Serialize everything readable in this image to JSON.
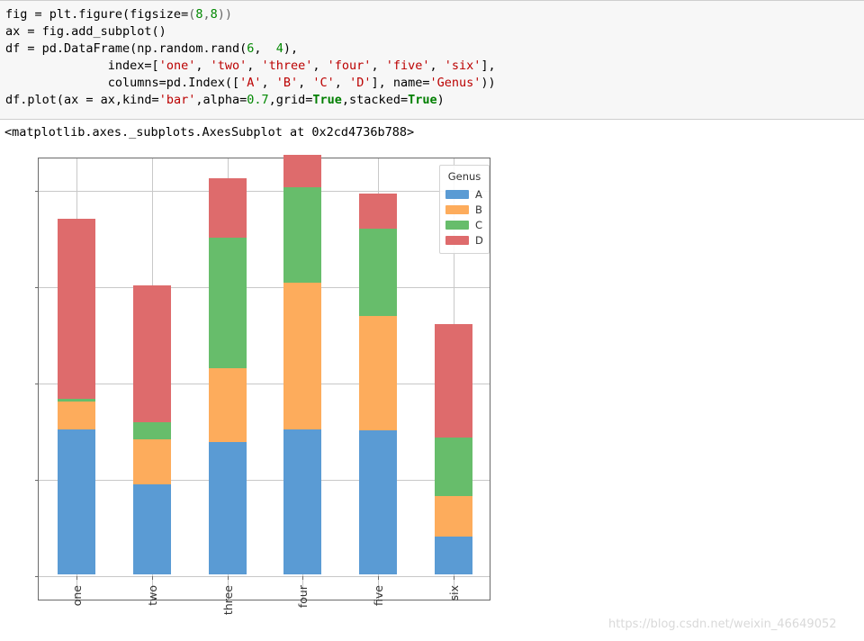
{
  "code_cell": {
    "lines": [
      [
        {
          "t": "fig = plt.figure(figsize=",
          "c": "pl"
        },
        {
          "t": "(",
          "c": "op"
        },
        {
          "t": "8",
          "c": "num"
        },
        {
          "t": ",",
          "c": "op"
        },
        {
          "t": "8",
          "c": "num"
        },
        {
          "t": "))",
          "c": "op"
        }
      ],
      [
        {
          "t": "ax = fig.add_subplot()",
          "c": "pl"
        }
      ],
      [
        {
          "t": "df = pd.DataFrame(np.random.rand(",
          "c": "pl"
        },
        {
          "t": "6",
          "c": "num"
        },
        {
          "t": ",  ",
          "c": "pl"
        },
        {
          "t": "4",
          "c": "num"
        },
        {
          "t": "),",
          "c": "pl"
        }
      ],
      [
        {
          "t": "              index=[",
          "c": "pl"
        },
        {
          "t": "'one'",
          "c": "str"
        },
        {
          "t": ", ",
          "c": "pl"
        },
        {
          "t": "'two'",
          "c": "str"
        },
        {
          "t": ", ",
          "c": "pl"
        },
        {
          "t": "'three'",
          "c": "str"
        },
        {
          "t": ", ",
          "c": "pl"
        },
        {
          "t": "'four'",
          "c": "str"
        },
        {
          "t": ", ",
          "c": "pl"
        },
        {
          "t": "'five'",
          "c": "str"
        },
        {
          "t": ", ",
          "c": "pl"
        },
        {
          "t": "'six'",
          "c": "str"
        },
        {
          "t": "],",
          "c": "pl"
        }
      ],
      [
        {
          "t": "              columns=pd.Index([",
          "c": "pl"
        },
        {
          "t": "'A'",
          "c": "str"
        },
        {
          "t": ", ",
          "c": "pl"
        },
        {
          "t": "'B'",
          "c": "str"
        },
        {
          "t": ", ",
          "c": "pl"
        },
        {
          "t": "'C'",
          "c": "str"
        },
        {
          "t": ", ",
          "c": "pl"
        },
        {
          "t": "'D'",
          "c": "str"
        },
        {
          "t": "], name=",
          "c": "pl"
        },
        {
          "t": "'Genus'",
          "c": "str"
        },
        {
          "t": "))",
          "c": "pl"
        }
      ],
      [
        {
          "t": "df.plot(ax = ax,kind=",
          "c": "pl"
        },
        {
          "t": "'bar'",
          "c": "str"
        },
        {
          "t": ",alpha=",
          "c": "pl"
        },
        {
          "t": "0.7",
          "c": "num"
        },
        {
          "t": ",grid=",
          "c": "pl"
        },
        {
          "t": "True",
          "c": "kw"
        },
        {
          "t": ",stacked=",
          "c": "pl"
        },
        {
          "t": "True",
          "c": "kw"
        },
        {
          "t": ")",
          "c": "pl"
        }
      ]
    ]
  },
  "output": {
    "repr_text": "<matplotlib.axes._subplots.AxesSubplot at 0x2cd4736b788>"
  },
  "watermark": {
    "text": "https://blog.csdn.net/weixin_46649052"
  },
  "chart_data": {
    "type": "bar",
    "stacked": true,
    "title": "",
    "xlabel": "",
    "ylabel": "",
    "grid": true,
    "alpha": 0.7,
    "legend_title": "Genus",
    "legend_position": "upper right",
    "categories": [
      "one",
      "two",
      "three",
      "four",
      "five",
      "six"
    ],
    "ylim": [
      0.0,
      2.3
    ],
    "yticks": [
      "0.0",
      "0.5",
      "1.0",
      "1.5",
      "2.0"
    ],
    "ytick_values": [
      0.0,
      0.5,
      1.0,
      1.5,
      2.0
    ],
    "series": [
      {
        "name": "A",
        "color": "#5a9bd4",
        "values": [
          0.752,
          0.467,
          0.687,
          0.752,
          0.748,
          0.196
        ]
      },
      {
        "name": "B",
        "color": "#fdac5c",
        "values": [
          0.145,
          0.234,
          0.383,
          0.762,
          0.593,
          0.21
        ]
      },
      {
        "name": "C",
        "color": "#67bd6b",
        "values": [
          0.012,
          0.089,
          0.678,
          0.495,
          0.453,
          0.304
        ]
      },
      {
        "name": "D",
        "color": "#de6b6c",
        "values": [
          0.939,
          0.71,
          0.308,
          0.168,
          0.182,
          0.589
        ]
      }
    ],
    "totals": [
      1.848,
      1.5,
      2.056,
      2.177,
      1.976,
      1.299
    ]
  }
}
